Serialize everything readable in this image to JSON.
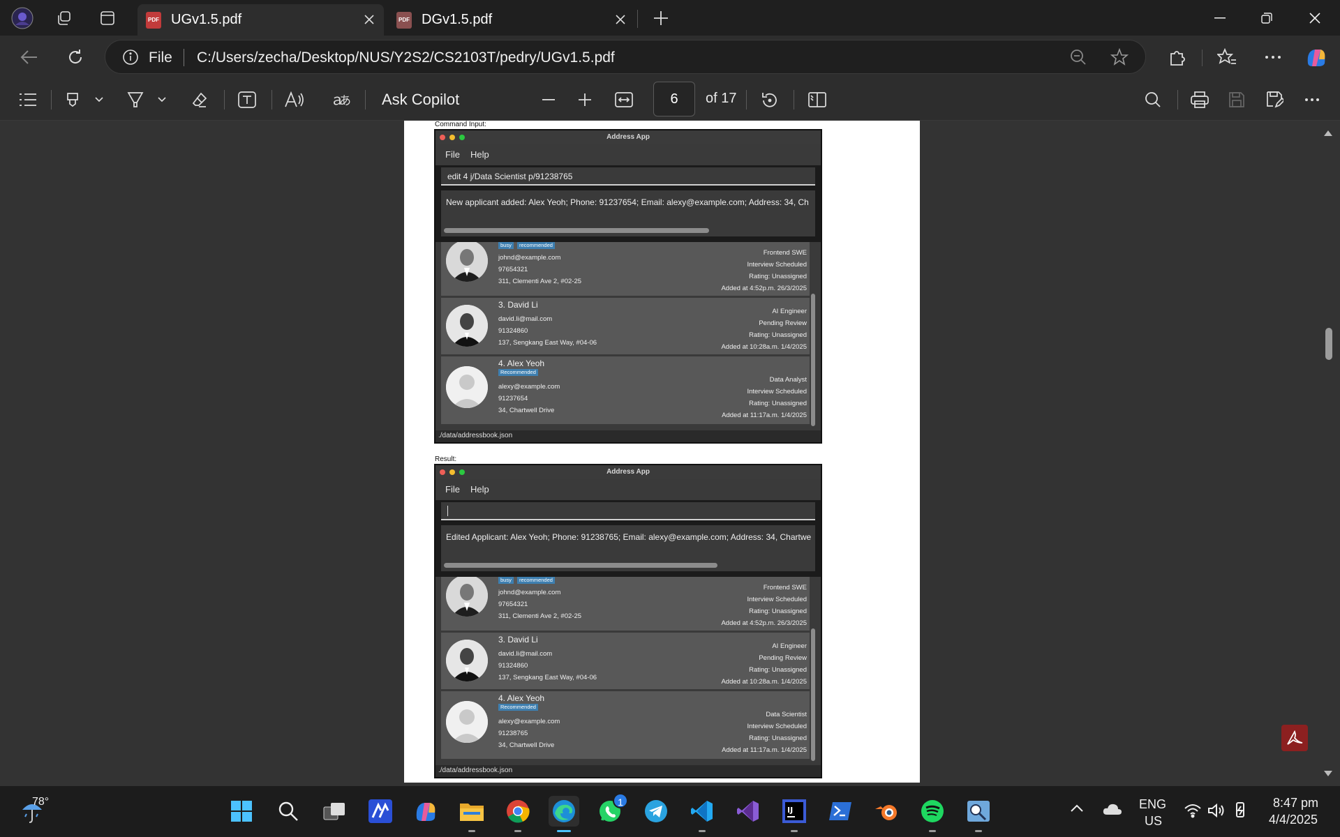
{
  "browser": {
    "tabs": [
      {
        "title": "UGv1.5.pdf",
        "active": true
      },
      {
        "title": "DGv1.5.pdf",
        "active": false
      }
    ],
    "address": {
      "scheme_label": "File",
      "url": "C:/Users/zecha/Desktop/NUS/Y2S2/CS2103T/pedry/UGv1.5.pdf"
    }
  },
  "pdf_toolbar": {
    "ask_copilot": "Ask Copilot",
    "page_current": "6",
    "page_total": "of 17"
  },
  "document": {
    "command_caption": "Command Input:",
    "result_caption": "Result:",
    "windows": [
      {
        "title": "Address App",
        "menu": [
          "File",
          "Help"
        ],
        "command": "edit 4 j/Data Scientist p/91238765",
        "result": "New applicant added: Alex Yeoh; Phone: 91237654; Email: alexy@example.com; Address: 34, Ch",
        "status": "./data/addressbook.json",
        "cards": [
          {
            "name": "",
            "tags": [
              "busy",
              "recommended"
            ],
            "email": "johnd@example.com",
            "phone": "97654321",
            "address": "311, Clementi Ave 2, #02-25",
            "job": "Frontend SWE",
            "stage": "Interview Scheduled",
            "rating": "Rating: Unassigned",
            "added": "Added at 4:52p.m. 26/3/2025"
          },
          {
            "name": "3. David Li",
            "tags": [],
            "email": "david.li@mail.com",
            "phone": "91324860",
            "address": "137, Sengkang East Way, #04-06",
            "job": "AI Engineer",
            "stage": "Pending Review",
            "rating": "Rating: Unassigned",
            "added": "Added at 10:28a.m. 1/4/2025"
          },
          {
            "name": "4. Alex Yeoh",
            "tags": [
              "Recommended"
            ],
            "email": "alexy@example.com",
            "phone": "91237654",
            "address": "34, Chartwell Drive",
            "job": "Data Analyst",
            "stage": "Interview Scheduled",
            "rating": "Rating: Unassigned",
            "added": "Added at 11:17a.m. 1/4/2025"
          }
        ]
      },
      {
        "title": "Address App",
        "menu": [
          "File",
          "Help"
        ],
        "command": "",
        "result": "Edited Applicant: Alex Yeoh; Phone: 91238765; Email: alexy@example.com; Address: 34, Chartwe",
        "status": "./data/addressbook.json",
        "cards": [
          {
            "name": "",
            "tags": [
              "busy",
              "recommended"
            ],
            "email": "johnd@example.com",
            "phone": "97654321",
            "address": "311, Clementi Ave 2, #02-25",
            "job": "Frontend SWE",
            "stage": "Interview Scheduled",
            "rating": "Rating: Unassigned",
            "added": "Added at 4:52p.m. 26/3/2025"
          },
          {
            "name": "3. David Li",
            "tags": [],
            "email": "david.li@mail.com",
            "phone": "91324860",
            "address": "137, Sengkang East Way, #04-06",
            "job": "AI Engineer",
            "stage": "Pending Review",
            "rating": "Rating: Unassigned",
            "added": "Added at 10:28a.m. 1/4/2025"
          },
          {
            "name": "4. Alex Yeoh",
            "tags": [
              "Recommended"
            ],
            "email": "alexy@example.com",
            "phone": "91238765",
            "address": "34, Chartwell Drive",
            "job": "Data Scientist",
            "stage": "Interview Scheduled",
            "rating": "Rating: Unassigned",
            "added": "Added at 11:17a.m. 1/4/2025"
          }
        ]
      }
    ]
  },
  "taskbar": {
    "weather_temp": "78°",
    "whatsapp_badge": "1",
    "language_line1": "ENG",
    "language_line2": "US",
    "time": "8:47 pm",
    "date": "4/4/2025"
  },
  "colors": {
    "accent": "#4cc2ff",
    "tag_blue": "#3e7fb0",
    "pdf_red": "#c23b3b"
  }
}
